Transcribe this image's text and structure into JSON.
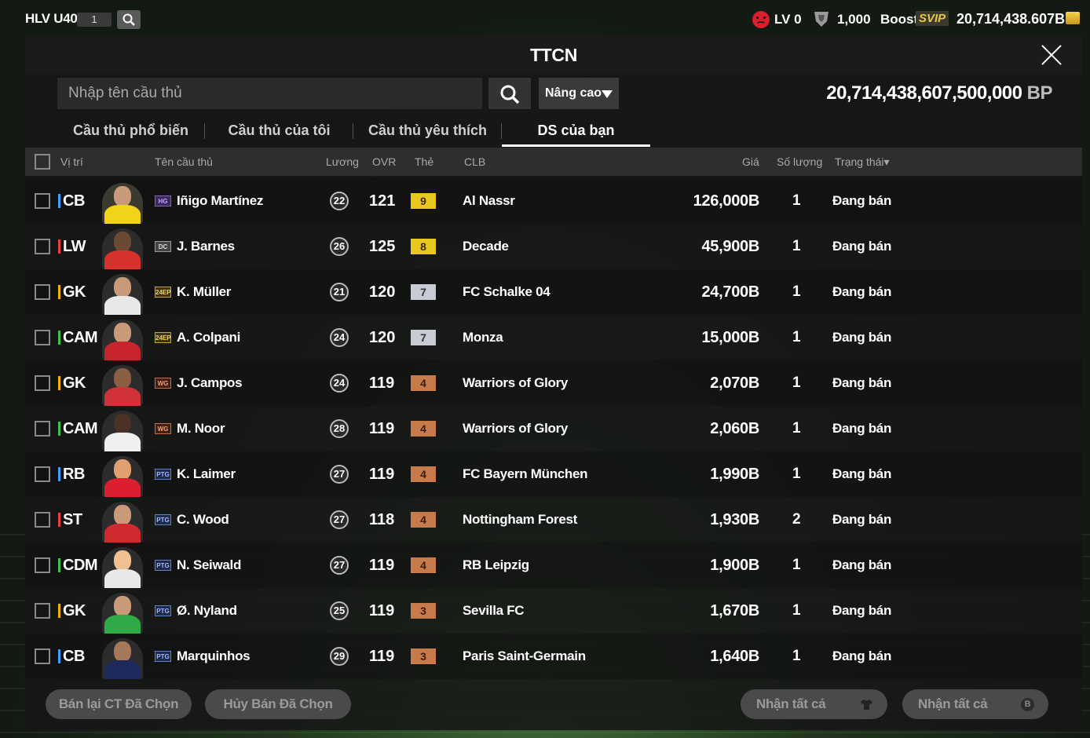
{
  "topbar": {
    "coach": "HLV U40",
    "coach_num": "1",
    "lv": "LV 0",
    "coins": "1,000",
    "boost": "Boost",
    "svip": "SVIP",
    "bp": "20,714,438.607B"
  },
  "modal": {
    "title": "TTCN",
    "search_placeholder": "Nhập tên cầu thủ",
    "advanced": "Nâng cao",
    "bp_total": "20,714,438,607,500,000",
    "bp_unit": "BP",
    "tabs": [
      "Cầu thủ phổ biến",
      "Cầu thủ của tôi",
      "Cầu thủ yêu thích",
      "DS của bạn"
    ]
  },
  "columns": {
    "pos": "Vị trí",
    "name": "Tên cầu thủ",
    "wage": "Lương",
    "ovr": "OVR",
    "level": "Thẻ",
    "club": "CLB",
    "price": "Giá",
    "qty": "Số lượng",
    "status": "Trạng thái▾"
  },
  "rows": [
    {
      "pos": "CB",
      "name": "Iñigo Martínez",
      "season": "HG",
      "wage": "22",
      "ovr": "121",
      "level": "9",
      "club": "Al Nassr",
      "price": "126,000B",
      "qty": "1",
      "status": "Đang bán"
    },
    {
      "pos": "LW",
      "name": "J. Barnes",
      "season": "DC",
      "wage": "26",
      "ovr": "125",
      "level": "8",
      "club": "Decade",
      "price": "45,900B",
      "qty": "1",
      "status": "Đang bán"
    },
    {
      "pos": "GK",
      "name": "K. Müller",
      "season": "24EP",
      "wage": "21",
      "ovr": "120",
      "level": "7",
      "club": "FC Schalke 04",
      "price": "24,700B",
      "qty": "1",
      "status": "Đang bán"
    },
    {
      "pos": "CAM",
      "name": "A. Colpani",
      "season": "24EP",
      "wage": "24",
      "ovr": "120",
      "level": "7",
      "club": "Monza",
      "price": "15,000B",
      "qty": "1",
      "status": "Đang bán"
    },
    {
      "pos": "GK",
      "name": "J. Campos",
      "season": "WG",
      "wage": "24",
      "ovr": "119",
      "level": "4",
      "club": "Warriors of Glory",
      "price": "2,070B",
      "qty": "1",
      "status": "Đang bán"
    },
    {
      "pos": "CAM",
      "name": "M. Noor",
      "season": "WG",
      "wage": "28",
      "ovr": "119",
      "level": "4",
      "club": "Warriors of Glory",
      "price": "2,060B",
      "qty": "1",
      "status": "Đang bán"
    },
    {
      "pos": "RB",
      "name": "K. Laimer",
      "season": "PTG",
      "wage": "27",
      "ovr": "119",
      "level": "4",
      "club": "FC Bayern München",
      "price": "1,990B",
      "qty": "1",
      "status": "Đang bán"
    },
    {
      "pos": "ST",
      "name": "C. Wood",
      "season": "PTG",
      "wage": "27",
      "ovr": "118",
      "level": "4",
      "club": "Nottingham Forest",
      "price": "1,930B",
      "qty": "2",
      "status": "Đang bán"
    },
    {
      "pos": "CDM",
      "name": "N. Seiwald",
      "season": "PTG",
      "wage": "27",
      "ovr": "119",
      "level": "4",
      "club": "RB Leipzig",
      "price": "1,900B",
      "qty": "1",
      "status": "Đang bán"
    },
    {
      "pos": "GK",
      "name": "Ø. Nyland",
      "season": "PTG",
      "wage": "25",
      "ovr": "119",
      "level": "3",
      "club": "Sevilla FC",
      "price": "1,670B",
      "qty": "1",
      "status": "Đang bán"
    },
    {
      "pos": "CB",
      "name": "Marquinhos",
      "season": "PTG",
      "wage": "29",
      "ovr": "119",
      "level": "3",
      "club": "Paris Saint-Germain",
      "price": "1,640B",
      "qty": "1",
      "status": "Đang bán"
    }
  ],
  "buttons": {
    "resell": "Bán lại CT Đã Chọn",
    "cancel": "Hủy Bán Đã Chọn",
    "receive_all_1": "Nhận tất cả",
    "receive_all_2": "Nhận tất cả"
  },
  "colors": {
    "pos_cb": "#3aa0ff",
    "pos_lw": "#e84040",
    "pos_gk": "#f0b400",
    "pos_cam": "#3fc24a",
    "level_9": "#e8c81e",
    "level_8": "#e8c81e",
    "level_7": "#c7cbd3",
    "level_4": "#c77a4a",
    "level_3": "#c77a4a"
  }
}
